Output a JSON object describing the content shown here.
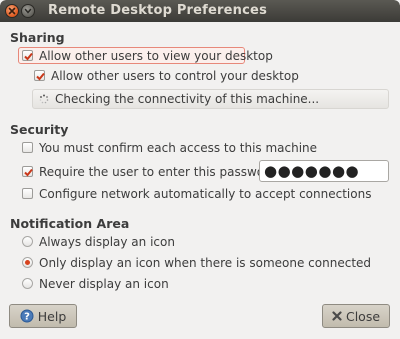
{
  "window": {
    "title": "Remote Desktop Preferences"
  },
  "sharing": {
    "title": "Sharing",
    "allow_view_label": "Allow other users to view your desktop",
    "allow_control_label": "Allow other users to control your desktop",
    "connectivity_status": "Checking the connectivity of this machine..."
  },
  "security": {
    "title": "Security",
    "confirm_access_label": "You must confirm each access to this machine",
    "require_password_label": "Require the user to enter this password:",
    "password_value": "●●●●●●●",
    "configure_network_label": "Configure network automatically to accept connections"
  },
  "notification": {
    "title": "Notification Area",
    "always_label": "Always display an icon",
    "only_connected_label": "Only display an icon when there is someone connected",
    "never_label": "Never display an icon"
  },
  "buttons": {
    "help": "Help",
    "close": "Close"
  },
  "colors": {
    "accent": "#d7431e",
    "titlebar": "#3c3b37",
    "background": "#f2f1f0"
  },
  "icons": {
    "help": "help-icon",
    "close": "close-x-icon",
    "spinner": "spinner-icon"
  }
}
